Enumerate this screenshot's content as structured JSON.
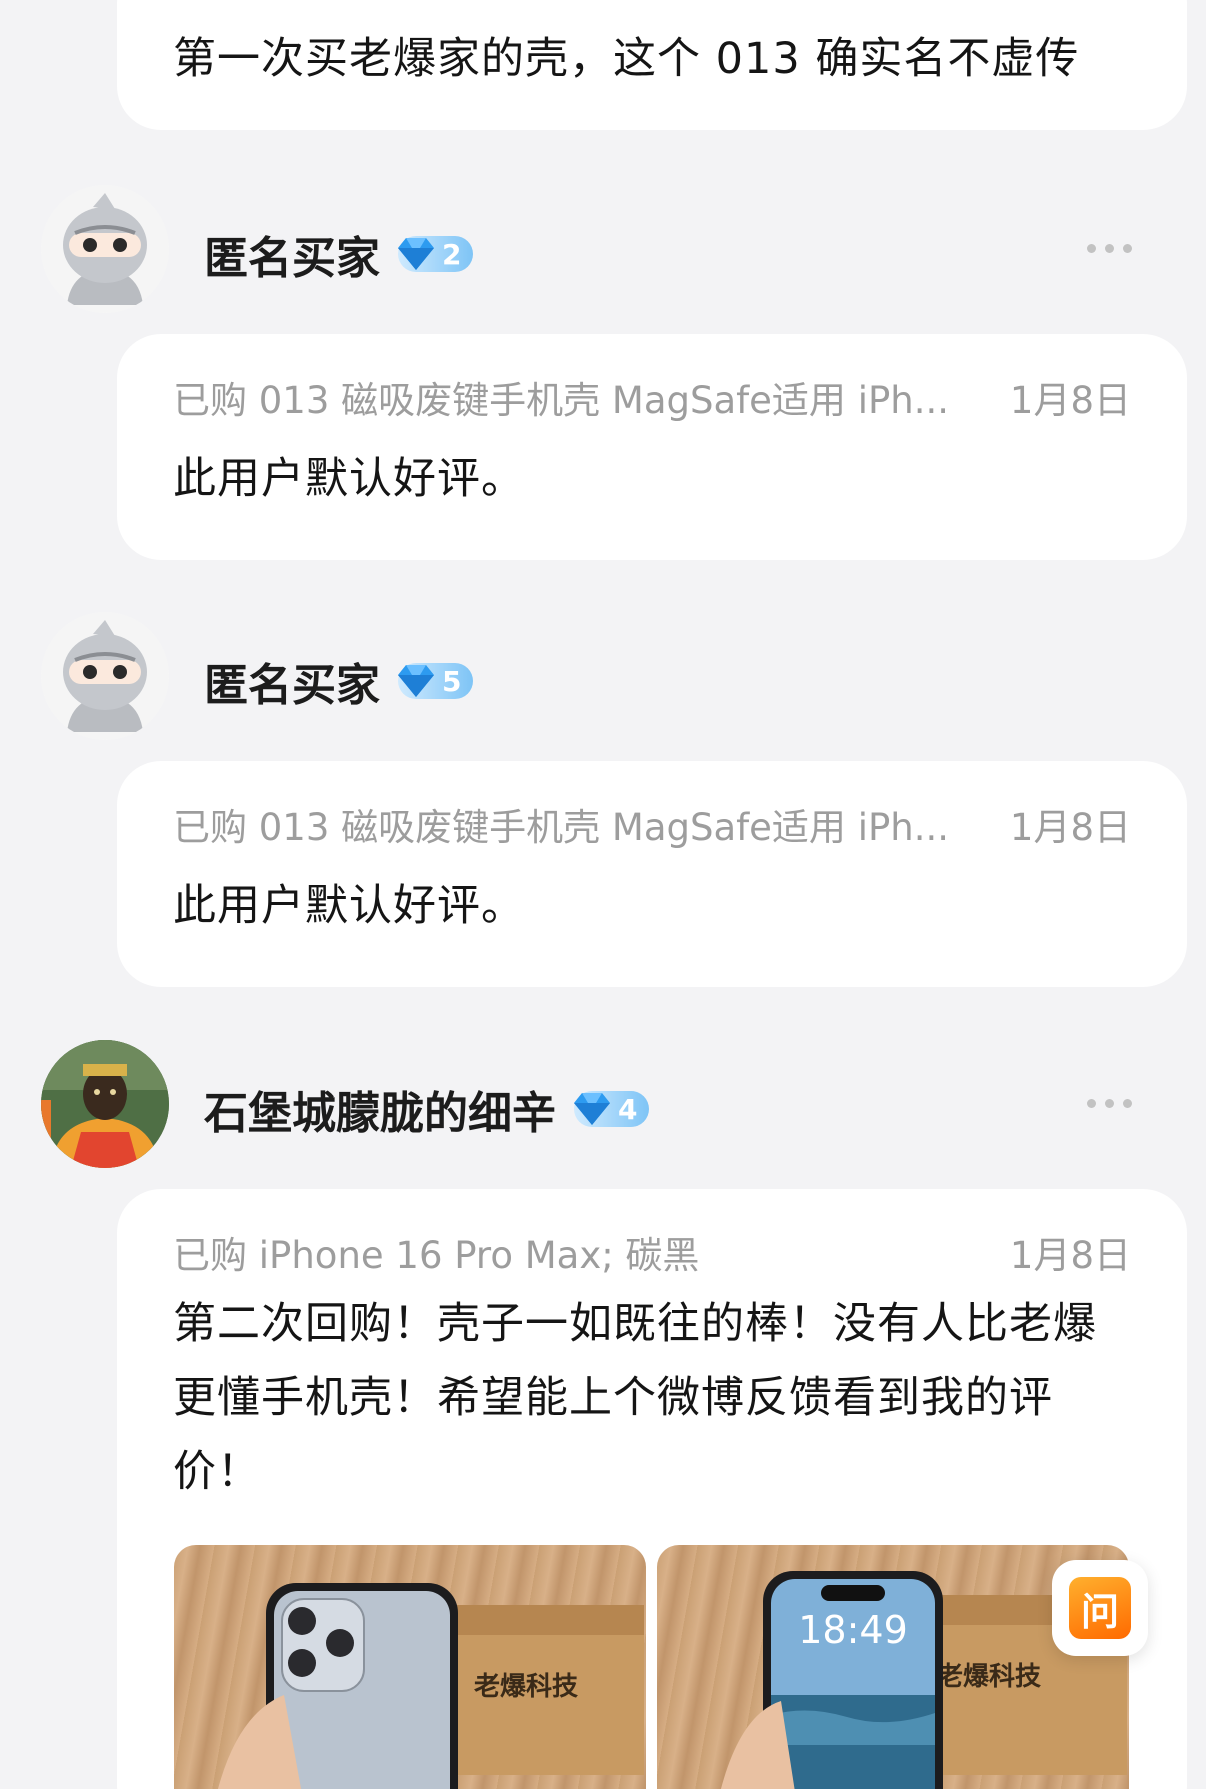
{
  "first_review": {
    "text": "第一次买老爆家的壳，这个 013 确实名不虚传"
  },
  "reviews": [
    {
      "username": "匿名买家",
      "level": "2",
      "purchased": "已购 013 磁吸废键手机壳 MagSafe适用 iPh...",
      "date": "1月8日",
      "text": "此用户默认好评。"
    },
    {
      "username": "匿名买家",
      "level": "5",
      "purchased": "已购 013 磁吸废键手机壳 MagSafe适用 iPh...",
      "date": "1月8日",
      "text": "此用户默认好评。"
    },
    {
      "username": "石堡城朦胧的细辛",
      "level": "4",
      "purchased": "已购 iPhone 16 Pro Max; 碳黑",
      "date": "1月8日",
      "text_lines": [
        "第二次回购！壳子一如既往的棒！没有人比老爆",
        "更懂手机壳！希望能上个微博反馈看到我的评",
        "价！"
      ],
      "photos": [
        {
          "box_brand": "老爆科技"
        },
        {
          "box_brand": "老爆科技",
          "lock_time": "18:49"
        }
      ]
    }
  ],
  "ask_button": {
    "label": "问"
  },
  "colors": {
    "background": "#f3f3f5",
    "card": "#ffffff",
    "meta_text": "#9d9d9d",
    "badge_start": "#cfeafe",
    "badge_end": "#7ec4f6",
    "ask_orange": "#ff6a00"
  },
  "icons": {
    "avatar_default": "ninja-avatar-icon",
    "level_badge": "diamond-icon",
    "more_menu": "more-dots-icon"
  }
}
